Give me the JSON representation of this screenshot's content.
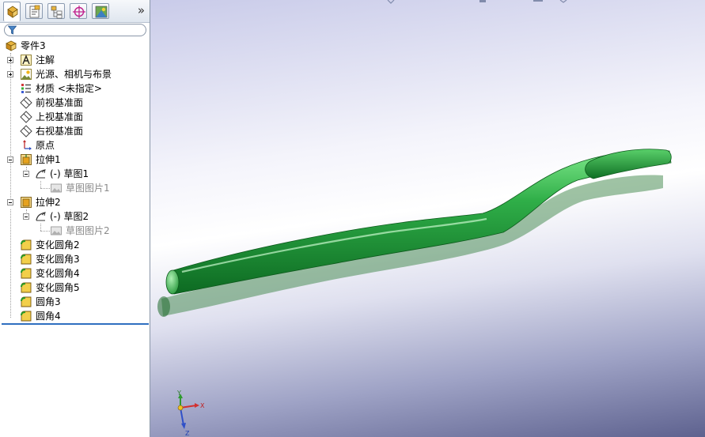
{
  "panel_tabs": [
    {
      "name": "featuremanager",
      "icon": "featuremanager-tree-icon",
      "active": true
    },
    {
      "name": "propertymanager",
      "icon": "propertymanager-icon",
      "active": false
    },
    {
      "name": "configurationmanager",
      "icon": "configurationmanager-icon",
      "active": false
    },
    {
      "name": "dimxpertmanager",
      "icon": "dimxpert-target-icon",
      "active": false
    },
    {
      "name": "display-manager",
      "icon": "display-manager-icon",
      "active": false
    }
  ],
  "panel_more": "»",
  "filter": {
    "icon": "filter-funnel-icon",
    "value": ""
  },
  "tree": {
    "root": "零件3",
    "annotations": "注解",
    "lights": "光源、相机与布景",
    "material": "材质 <未指定>",
    "front_plane": "前视基准面",
    "top_plane": "上视基准面",
    "right_plane": "右视基准面",
    "origin": "原点",
    "extrude1": "拉伸1",
    "sketch1": "(-) 草图1",
    "sketch_picture1": "草图图片1",
    "extrude2": "拉伸2",
    "sketch2": "(-) 草图2",
    "sketch_picture2": "草图图片2",
    "var_fillet2": "变化圆角2",
    "var_fillet3": "变化圆角3",
    "var_fillet4": "变化圆角4",
    "var_fillet5": "变化圆角5",
    "fillet3": "圆角3",
    "fillet4": "圆角4"
  },
  "triad": {
    "x": "X",
    "y": "Y",
    "z": "Z"
  },
  "colors": {
    "model": "#1f9a3c",
    "rollback_bar": "#2f6fc0",
    "tree_text": "#000000",
    "dim_text": "#8a8a8a"
  }
}
